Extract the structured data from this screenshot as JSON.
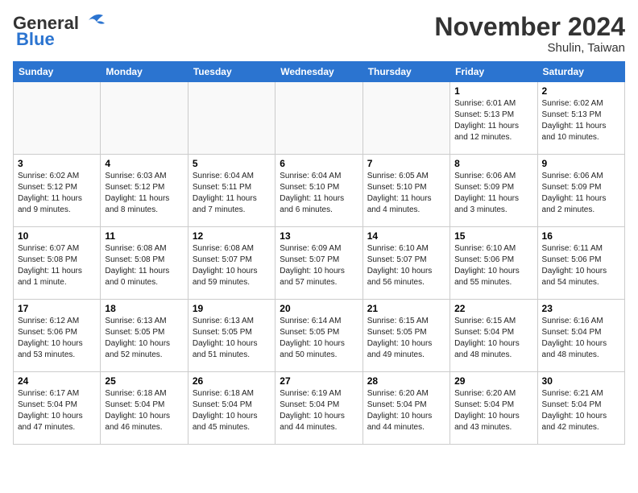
{
  "header": {
    "logo_general": "General",
    "logo_blue": "Blue",
    "month": "November 2024",
    "location": "Shulin, Taiwan"
  },
  "weekdays": [
    "Sunday",
    "Monday",
    "Tuesday",
    "Wednesday",
    "Thursday",
    "Friday",
    "Saturday"
  ],
  "weeks": [
    [
      {
        "day": "",
        "info": ""
      },
      {
        "day": "",
        "info": ""
      },
      {
        "day": "",
        "info": ""
      },
      {
        "day": "",
        "info": ""
      },
      {
        "day": "",
        "info": ""
      },
      {
        "day": "1",
        "info": "Sunrise: 6:01 AM\nSunset: 5:13 PM\nDaylight: 11 hours and 12 minutes."
      },
      {
        "day": "2",
        "info": "Sunrise: 6:02 AM\nSunset: 5:13 PM\nDaylight: 11 hours and 10 minutes."
      }
    ],
    [
      {
        "day": "3",
        "info": "Sunrise: 6:02 AM\nSunset: 5:12 PM\nDaylight: 11 hours and 9 minutes."
      },
      {
        "day": "4",
        "info": "Sunrise: 6:03 AM\nSunset: 5:12 PM\nDaylight: 11 hours and 8 minutes."
      },
      {
        "day": "5",
        "info": "Sunrise: 6:04 AM\nSunset: 5:11 PM\nDaylight: 11 hours and 7 minutes."
      },
      {
        "day": "6",
        "info": "Sunrise: 6:04 AM\nSunset: 5:10 PM\nDaylight: 11 hours and 6 minutes."
      },
      {
        "day": "7",
        "info": "Sunrise: 6:05 AM\nSunset: 5:10 PM\nDaylight: 11 hours and 4 minutes."
      },
      {
        "day": "8",
        "info": "Sunrise: 6:06 AM\nSunset: 5:09 PM\nDaylight: 11 hours and 3 minutes."
      },
      {
        "day": "9",
        "info": "Sunrise: 6:06 AM\nSunset: 5:09 PM\nDaylight: 11 hours and 2 minutes."
      }
    ],
    [
      {
        "day": "10",
        "info": "Sunrise: 6:07 AM\nSunset: 5:08 PM\nDaylight: 11 hours and 1 minute."
      },
      {
        "day": "11",
        "info": "Sunrise: 6:08 AM\nSunset: 5:08 PM\nDaylight: 11 hours and 0 minutes."
      },
      {
        "day": "12",
        "info": "Sunrise: 6:08 AM\nSunset: 5:07 PM\nDaylight: 10 hours and 59 minutes."
      },
      {
        "day": "13",
        "info": "Sunrise: 6:09 AM\nSunset: 5:07 PM\nDaylight: 10 hours and 57 minutes."
      },
      {
        "day": "14",
        "info": "Sunrise: 6:10 AM\nSunset: 5:07 PM\nDaylight: 10 hours and 56 minutes."
      },
      {
        "day": "15",
        "info": "Sunrise: 6:10 AM\nSunset: 5:06 PM\nDaylight: 10 hours and 55 minutes."
      },
      {
        "day": "16",
        "info": "Sunrise: 6:11 AM\nSunset: 5:06 PM\nDaylight: 10 hours and 54 minutes."
      }
    ],
    [
      {
        "day": "17",
        "info": "Sunrise: 6:12 AM\nSunset: 5:06 PM\nDaylight: 10 hours and 53 minutes."
      },
      {
        "day": "18",
        "info": "Sunrise: 6:13 AM\nSunset: 5:05 PM\nDaylight: 10 hours and 52 minutes."
      },
      {
        "day": "19",
        "info": "Sunrise: 6:13 AM\nSunset: 5:05 PM\nDaylight: 10 hours and 51 minutes."
      },
      {
        "day": "20",
        "info": "Sunrise: 6:14 AM\nSunset: 5:05 PM\nDaylight: 10 hours and 50 minutes."
      },
      {
        "day": "21",
        "info": "Sunrise: 6:15 AM\nSunset: 5:05 PM\nDaylight: 10 hours and 49 minutes."
      },
      {
        "day": "22",
        "info": "Sunrise: 6:15 AM\nSunset: 5:04 PM\nDaylight: 10 hours and 48 minutes."
      },
      {
        "day": "23",
        "info": "Sunrise: 6:16 AM\nSunset: 5:04 PM\nDaylight: 10 hours and 48 minutes."
      }
    ],
    [
      {
        "day": "24",
        "info": "Sunrise: 6:17 AM\nSunset: 5:04 PM\nDaylight: 10 hours and 47 minutes."
      },
      {
        "day": "25",
        "info": "Sunrise: 6:18 AM\nSunset: 5:04 PM\nDaylight: 10 hours and 46 minutes."
      },
      {
        "day": "26",
        "info": "Sunrise: 6:18 AM\nSunset: 5:04 PM\nDaylight: 10 hours and 45 minutes."
      },
      {
        "day": "27",
        "info": "Sunrise: 6:19 AM\nSunset: 5:04 PM\nDaylight: 10 hours and 44 minutes."
      },
      {
        "day": "28",
        "info": "Sunrise: 6:20 AM\nSunset: 5:04 PM\nDaylight: 10 hours and 44 minutes."
      },
      {
        "day": "29",
        "info": "Sunrise: 6:20 AM\nSunset: 5:04 PM\nDaylight: 10 hours and 43 minutes."
      },
      {
        "day": "30",
        "info": "Sunrise: 6:21 AM\nSunset: 5:04 PM\nDaylight: 10 hours and 42 minutes."
      }
    ]
  ]
}
